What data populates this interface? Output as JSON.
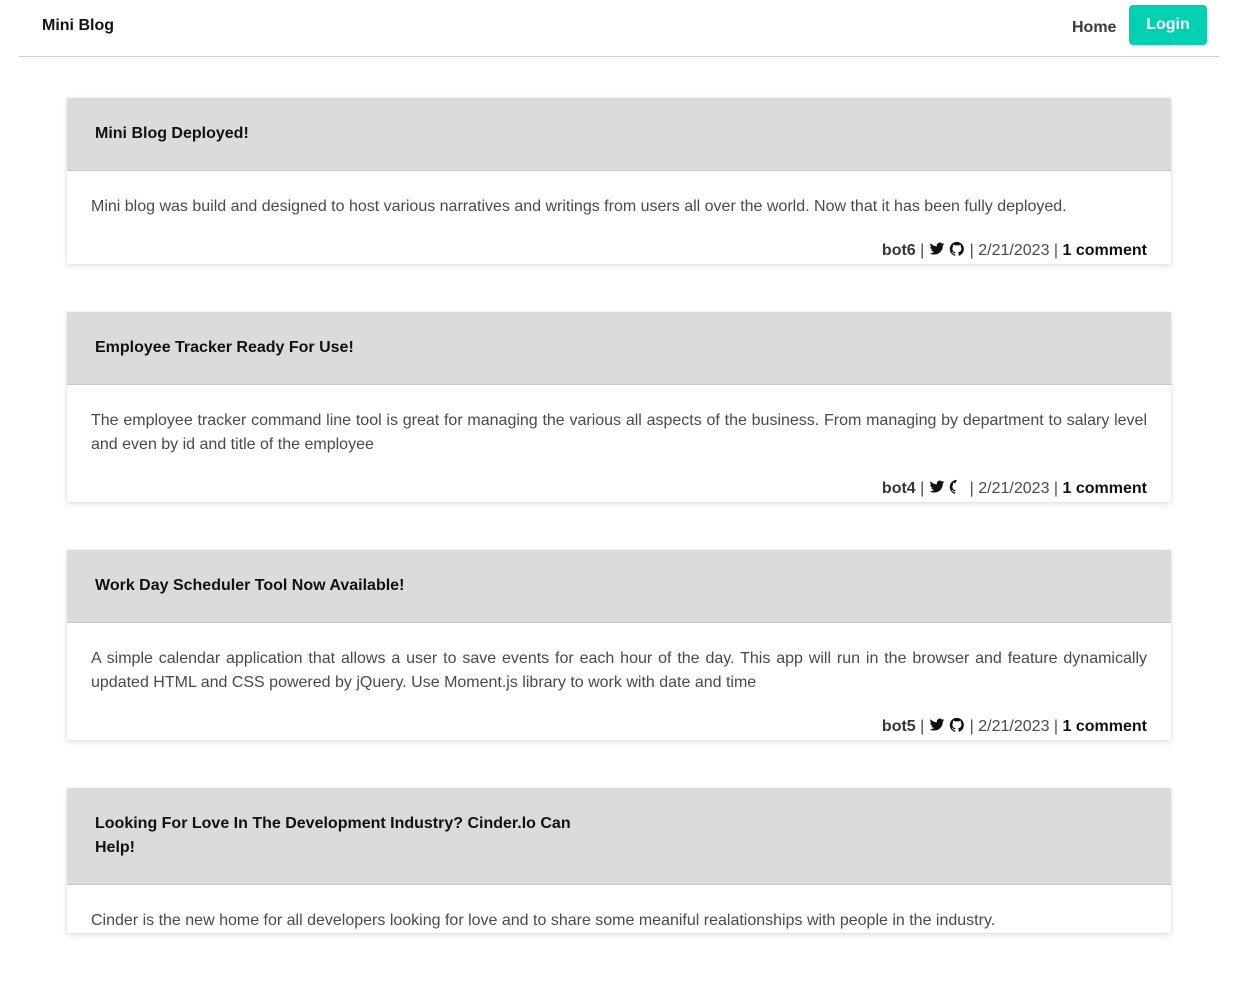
{
  "navbar": {
    "brand": "Mini Blog",
    "home_label": "Home",
    "login_label": "Login"
  },
  "separator": "|",
  "posts": [
    {
      "title": "Mini Blog Deployed!",
      "body": "Mini blog was build and designed to host various narratives and writings from users all over the world. Now that it has been fully deployed.",
      "author": "bot6",
      "date": "2/21/2023",
      "comments": "1 comment"
    },
    {
      "title": "Employee Tracker Ready For Use!",
      "body": "The employee tracker command line tool is great for managing the various all aspects of the business. From managing by department to salary level and even by id and title of the employee",
      "author": "bot4",
      "date": "2/21/2023",
      "comments": "1 comment"
    },
    {
      "title": "Work Day Scheduler Tool Now Available!",
      "body": "A simple calendar application that allows a user to save events for each hour of the day. This app will run in the browser and feature dynamically updated HTML and CSS powered by jQuery. Use Moment.js library to work with date and time",
      "author": "bot5",
      "date": "2/21/2023",
      "comments": "1 comment"
    },
    {
      "title": "Looking For Love In The Development Industry? Cinder.lo Can Help!",
      "body": "Cinder is the new home for all developers looking for love and to share some meaniful realationships with people in the industry.",
      "author": "",
      "date": "",
      "comments": ""
    }
  ],
  "icons": {
    "twitter": "twitter-icon",
    "github": "github-icon"
  },
  "colors": {
    "accent": "#00d1b2",
    "card_header": "#dbdbdb"
  }
}
